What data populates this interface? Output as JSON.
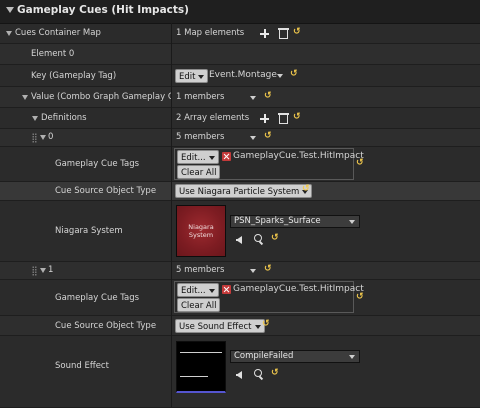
{
  "header": {
    "title": "Gameplay Cues (Hit Impacts)"
  },
  "cues_container_map": {
    "label": "Cues Container Map",
    "value": "1 Map elements"
  },
  "element_0": {
    "label": "Element 0"
  },
  "key": {
    "label": "Key (Gameplay Tag)",
    "edit_label": "Edit",
    "tag": "Event.Montage"
  },
  "value_row": {
    "label": "Value (Combo Graph Gameplay Cue C",
    "count": "1 members"
  },
  "definitions": {
    "label": "Definitions",
    "count": "2 Array elements"
  },
  "items": [
    {
      "index": "0",
      "members": "5 members",
      "tags_label": "Gameplay Cue Tags",
      "edit_label": "Edit...",
      "tag": "GameplayCue.Test.HitImpact",
      "clear_label": "Clear All",
      "source_label": "Cue Source Object Type",
      "source_value": "Use Niagara Particle System",
      "asset_label": "Niagara System",
      "thumb_text": "Niagara System",
      "asset_value": "PSN_Sparks_Surface"
    },
    {
      "index": "1",
      "members": "5 members",
      "tags_label": "Gameplay Cue Tags",
      "edit_label": "Edit...",
      "tag": "GameplayCue.Test.HitImpact",
      "clear_label": "Clear All",
      "source_label": "Cue Source Object Type",
      "source_value": "Use Sound Effect",
      "asset_label": "Sound Effect",
      "asset_value": "CompileFailed"
    }
  ],
  "colors": {
    "reset_arrow": "#f2c94c",
    "remove_tag": "#c43a3a",
    "niagara_thumb": "#8b2228",
    "sound_thumb_bar": "#5555d0"
  },
  "icons": [
    "collapse-arrow",
    "add-icon",
    "delete-icon",
    "reset-to-default-icon",
    "remove-tag-icon",
    "use-selected-icon",
    "browse-icon",
    "drag-handle-icon"
  ]
}
